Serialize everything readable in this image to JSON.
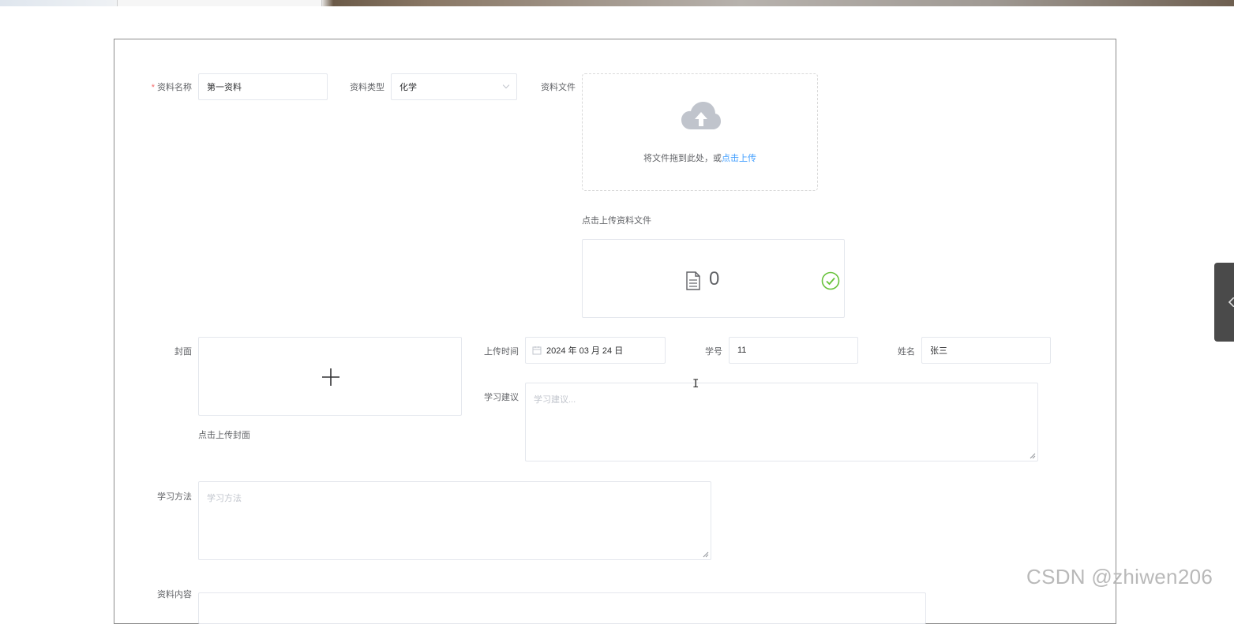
{
  "form": {
    "name": {
      "label": "资料名称",
      "required_mark": "*",
      "value": "第一资料"
    },
    "type": {
      "label": "资料类型",
      "value": "化学"
    },
    "file": {
      "label": "资料文件",
      "drag_text": "将文件拖到此处，或",
      "drag_link": "点击上传",
      "tip": "点击上传资料文件",
      "count": "0"
    },
    "cover": {
      "label": "封面",
      "tip": "点击上传封面"
    },
    "upload_time": {
      "label": "上传时间",
      "value": "2024 年 03 月 24 日"
    },
    "student_no": {
      "label": "学号",
      "value": "11"
    },
    "student_name": {
      "label": "姓名",
      "value": "张三"
    },
    "advice": {
      "label": "学习建议",
      "placeholder": "学习建议..."
    },
    "method": {
      "label": "学习方法",
      "placeholder": "学习方法"
    },
    "content": {
      "label": "资料内容"
    }
  },
  "watermark": "CSDN @zhiwen206",
  "colors": {
    "link": "#409eff",
    "required": "#f56c6c",
    "success": "#67c23a"
  }
}
